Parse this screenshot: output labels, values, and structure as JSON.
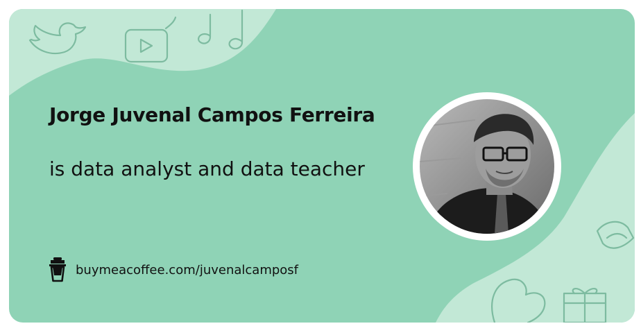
{
  "profile": {
    "name": "Jorge Juvenal Campos Ferreira",
    "tagline": "is data analyst and data teacher",
    "avatar_icon": "profile-photo"
  },
  "link": {
    "text": "buymeacoffee.com/juvenalcamposf",
    "icon": "coffee-cup-icon"
  },
  "colors": {
    "background": "#8fd3b6",
    "blob": "#c2e8d6",
    "doodle": "#7dbba0",
    "text": "#111111",
    "avatar_ring": "#ffffff"
  }
}
